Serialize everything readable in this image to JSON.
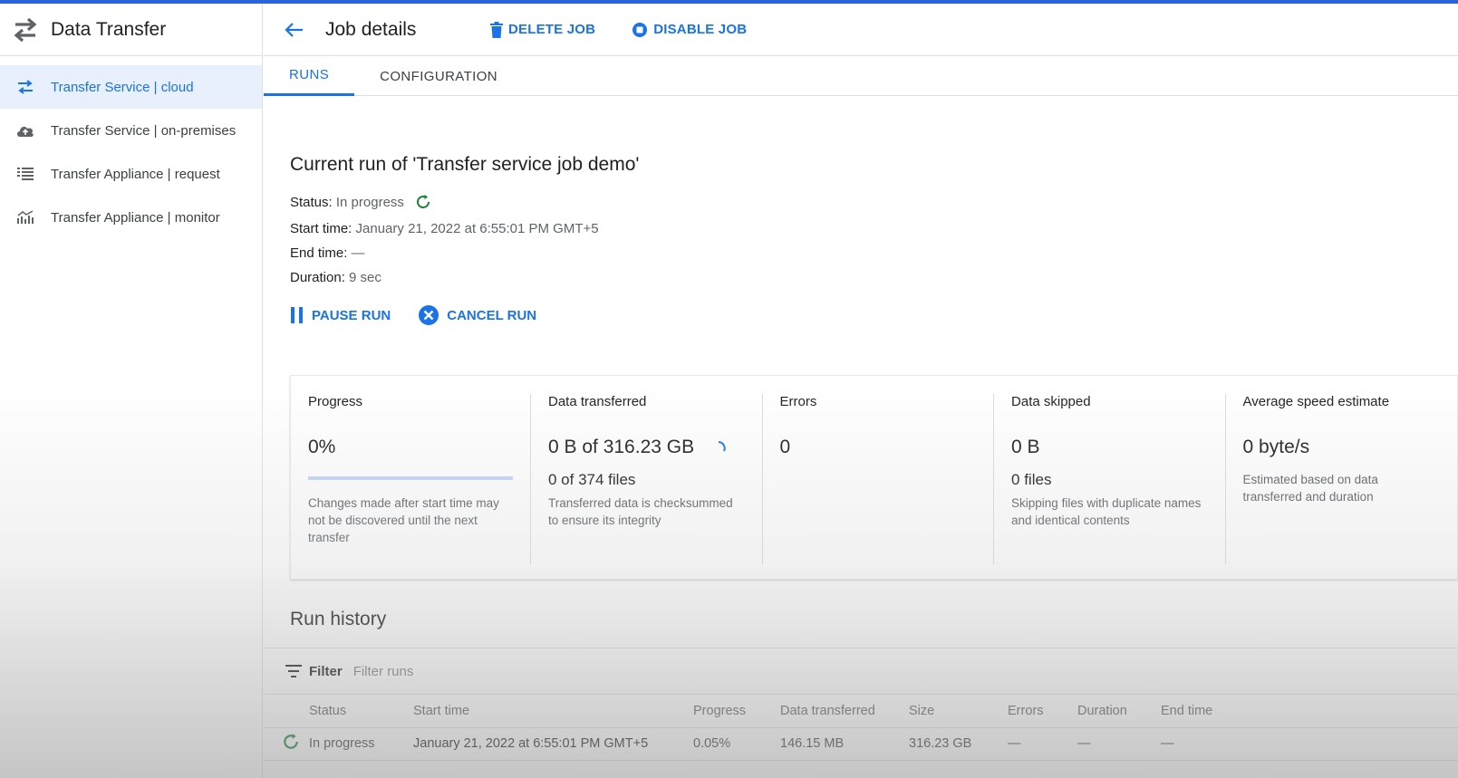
{
  "app": {
    "title": "Data Transfer"
  },
  "sidebar": {
    "items": [
      {
        "label": "Transfer Service | cloud",
        "icon": "swap-arrows-icon",
        "active": true
      },
      {
        "label": "Transfer Service | on-premises",
        "icon": "cloud-upload-icon",
        "active": false
      },
      {
        "label": "Transfer Appliance | request",
        "icon": "list-icon",
        "active": false
      },
      {
        "label": "Transfer Appliance | monitor",
        "icon": "chart-icon",
        "active": false
      }
    ]
  },
  "header": {
    "title": "Job details",
    "delete_label": "DELETE JOB",
    "disable_label": "DISABLE JOB"
  },
  "tabs": [
    {
      "label": "RUNS",
      "active": true
    },
    {
      "label": "CONFIGURATION",
      "active": false
    }
  ],
  "run": {
    "title": "Current run of 'Transfer service job demo'",
    "status_key": "Status:",
    "status_value": "In progress",
    "start_key": "Start time:",
    "start_value": "January 21, 2022 at 6:55:01 PM GMT+5",
    "end_key": "End time:",
    "end_value": "—",
    "duration_key": "Duration:",
    "duration_value": "9 sec",
    "pause_label": "PAUSE RUN",
    "cancel_label": "CANCEL RUN"
  },
  "stats": {
    "progress": {
      "label": "Progress",
      "value": "0%",
      "fraction": 0.0,
      "note": "Changes made after start time may not be discovered until the next transfer"
    },
    "transferred": {
      "label": "Data transferred",
      "value": "0 B of 316.23 GB",
      "sub": "0 of 374 files",
      "note": "Transferred data is checksummed to ensure its integrity"
    },
    "errors": {
      "label": "Errors",
      "value": "0"
    },
    "skipped": {
      "label": "Data skipped",
      "value": "0 B",
      "sub": "0 files",
      "note": "Skipping files with duplicate names and identical contents"
    },
    "speed": {
      "label": "Average speed estimate",
      "value": "0 byte/s",
      "note": "Estimated based on data transferred and duration"
    }
  },
  "history": {
    "title": "Run history",
    "filter_label": "Filter",
    "filter_placeholder": "Filter runs",
    "columns": [
      "Status",
      "Start time",
      "Progress",
      "Data transferred",
      "Size",
      "Errors",
      "Duration",
      "End time"
    ],
    "rows": [
      {
        "status": "In progress",
        "start": "January 21, 2022 at 6:55:01 PM GMT+5",
        "progress": "0.05%",
        "transferred": "146.15 MB",
        "size": "316.23 GB",
        "errors": "—",
        "duration": "—",
        "end": "—"
      }
    ]
  },
  "colors": {
    "accent": "#1a73e8",
    "success": "#188038",
    "topbar": "#2962d9"
  }
}
